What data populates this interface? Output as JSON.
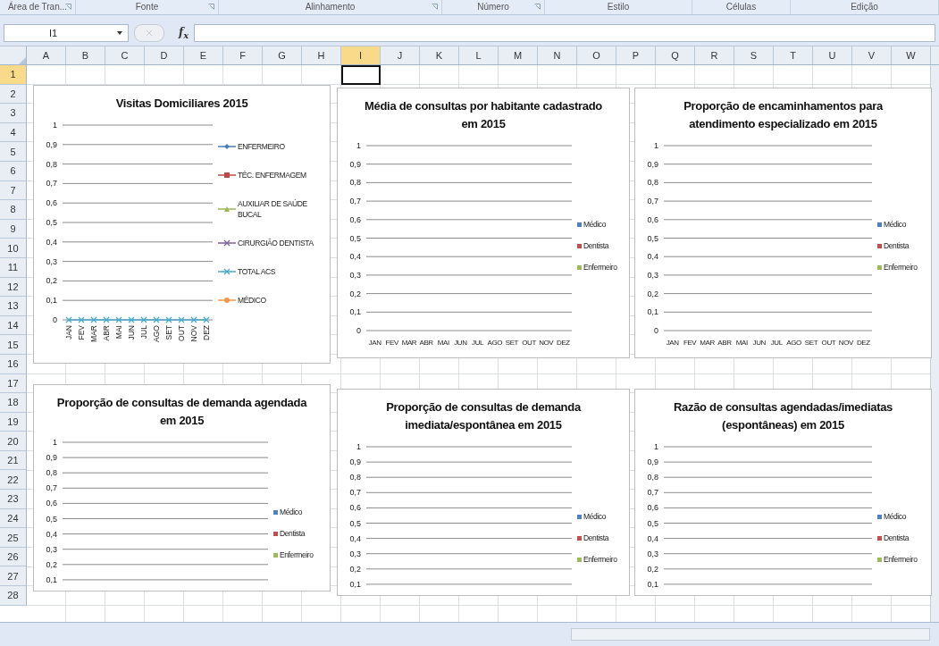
{
  "ribbon_groups": [
    {
      "label": "Área de Tran...",
      "has_launcher": true
    },
    {
      "label": "Fonte",
      "has_launcher": true
    },
    {
      "label": "Alinhamento",
      "has_launcher": true
    },
    {
      "label": "Número",
      "has_launcher": true
    },
    {
      "label": "Estilo",
      "has_launcher": false
    },
    {
      "label": "Células",
      "has_launcher": false
    },
    {
      "label": "Edição",
      "has_launcher": false
    }
  ],
  "formula_bar": {
    "name_box": "I1",
    "function_label": "f$_{x}$"
  },
  "columns": [
    {
      "label": "A",
      "selected": false
    },
    {
      "label": "B",
      "selected": false
    },
    {
      "label": "C",
      "selected": false
    },
    {
      "label": "D",
      "selected": false
    },
    {
      "label": "E",
      "selected": false
    },
    {
      "label": "F",
      "selected": false
    },
    {
      "label": "G",
      "selected": false
    },
    {
      "label": "H",
      "selected": false
    },
    {
      "label": "I",
      "selected": true
    },
    {
      "label": "J",
      "selected": false
    },
    {
      "label": "K",
      "selected": false
    },
    {
      "label": "L",
      "selected": false
    },
    {
      "label": "M",
      "selected": false
    },
    {
      "label": "N",
      "selected": false
    },
    {
      "label": "O",
      "selected": false
    },
    {
      "label": "P",
      "selected": false
    },
    {
      "label": "Q",
      "selected": false
    },
    {
      "label": "R",
      "selected": false
    },
    {
      "label": "S",
      "selected": false
    },
    {
      "label": "T",
      "selected": false
    },
    {
      "label": "U",
      "selected": false
    },
    {
      "label": "V",
      "selected": false
    },
    {
      "label": "W",
      "selected": false
    }
  ],
  "rows": [
    {
      "label": "1",
      "selected": true
    },
    {
      "label": "2",
      "selected": false
    },
    {
      "label": "3",
      "selected": false
    },
    {
      "label": "4",
      "selected": false
    },
    {
      "label": "5",
      "selected": false
    },
    {
      "label": "6",
      "selected": false
    },
    {
      "label": "7",
      "selected": false
    },
    {
      "label": "8",
      "selected": false
    },
    {
      "label": "9",
      "selected": false
    },
    {
      "label": "10",
      "selected": false
    },
    {
      "label": "11",
      "selected": false
    },
    {
      "label": "12",
      "selected": false
    },
    {
      "label": "13",
      "selected": false
    },
    {
      "label": "14",
      "selected": false
    },
    {
      "label": "15",
      "selected": false
    },
    {
      "label": "16",
      "selected": false
    },
    {
      "label": "17",
      "selected": false
    },
    {
      "label": "18",
      "selected": false
    },
    {
      "label": "19",
      "selected": false
    },
    {
      "label": "20",
      "selected": false
    },
    {
      "label": "21",
      "selected": false
    },
    {
      "label": "22",
      "selected": false
    },
    {
      "label": "23",
      "selected": false
    },
    {
      "label": "24",
      "selected": false
    },
    {
      "label": "25",
      "selected": false
    },
    {
      "label": "26",
      "selected": false
    },
    {
      "label": "27",
      "selected": false
    },
    {
      "label": "28",
      "selected": false
    }
  ],
  "charts": [
    {
      "chart_data": {
        "type": "line",
        "title": "Visitas Domiciliares 2015",
        "categories": [
          "JAN",
          "FEV",
          "MAR",
          "ABR",
          "MAI",
          "JUN",
          "JUL",
          "AGO",
          "SET",
          "OUT",
          "NOV",
          "DEZ"
        ],
        "ylim": [
          0,
          1
        ],
        "yticks": [
          {
            "value": 0,
            "label": "0"
          },
          {
            "value": 0.1,
            "label": "0,1"
          },
          {
            "value": 0.2,
            "label": "0,2"
          },
          {
            "value": 0.3,
            "label": "0,3"
          },
          {
            "value": 0.4,
            "label": "0,4"
          },
          {
            "value": 0.5,
            "label": "0,5"
          },
          {
            "value": 0.6,
            "label": "0,6"
          },
          {
            "value": 0.7,
            "label": "0,7"
          },
          {
            "value": 0.8,
            "label": "0,8"
          },
          {
            "value": 0.9,
            "label": "0,9"
          },
          {
            "value": 1,
            "label": "1"
          }
        ],
        "series": [
          {
            "name": "ENFERMEIRO",
            "color": "#4a7ebb",
            "marker": "diamond",
            "values": [
              null,
              null,
              null,
              null,
              null,
              null,
              null,
              null,
              null,
              null,
              null,
              null
            ]
          },
          {
            "name": "TÉC. ENFERMAGEM",
            "color": "#be4b48",
            "marker": "square",
            "values": [
              null,
              null,
              null,
              null,
              null,
              null,
              null,
              null,
              null,
              null,
              null,
              null
            ]
          },
          {
            "name": "AUXILIAR DE SAÚDE BUCAL",
            "color": "#98b954",
            "marker": "triangle",
            "values": [
              null,
              null,
              null,
              null,
              null,
              null,
              null,
              null,
              null,
              null,
              null,
              null
            ]
          },
          {
            "name": "CIRURGIÃO DENTISTA",
            "color": "#7d60a0",
            "marker": "cross",
            "values": [
              null,
              null,
              null,
              null,
              null,
              null,
              null,
              null,
              null,
              null,
              null,
              null
            ]
          },
          {
            "name": "TOTAL ACS",
            "color": "#46aac5",
            "marker": "cross",
            "values": [
              0,
              0,
              0,
              0,
              0,
              0,
              0,
              0,
              0,
              0,
              0,
              0
            ]
          },
          {
            "name": "MÉDICO",
            "color": "#f79646",
            "marker": "circle",
            "values": [
              null,
              null,
              null,
              null,
              null,
              null,
              null,
              null,
              null,
              null,
              null,
              null
            ]
          }
        ],
        "grid": true,
        "legend": "right"
      }
    },
    {
      "chart_data": {
        "type": "bar",
        "title": "Média de consultas por habitante cadastrado em 2015",
        "categories": [
          "JAN",
          "FEV",
          "MAR",
          "ABR",
          "MAI",
          "JUN",
          "JUL",
          "AGO",
          "SET",
          "OUT",
          "NOV",
          "DEZ"
        ],
        "ylim": [
          0,
          1
        ],
        "yticks": [
          {
            "value": 0,
            "label": "0"
          },
          {
            "value": 0.1,
            "label": "0,1"
          },
          {
            "value": 0.2,
            "label": "0,2"
          },
          {
            "value": 0.3,
            "label": "0,3"
          },
          {
            "value": 0.4,
            "label": "0,4"
          },
          {
            "value": 0.5,
            "label": "0,5"
          },
          {
            "value": 0.6,
            "label": "0,6"
          },
          {
            "value": 0.7,
            "label": "0,7"
          },
          {
            "value": 0.8,
            "label": "0,8"
          },
          {
            "value": 0.9,
            "label": "0,9"
          },
          {
            "value": 1,
            "label": "1"
          }
        ],
        "series": [
          {
            "name": "Médico",
            "color": "#4f81bd",
            "values": [
              0,
              0,
              0,
              0,
              0,
              0,
              0,
              0,
              0,
              0,
              0,
              0
            ]
          },
          {
            "name": "Dentista",
            "color": "#c0504d",
            "values": [
              0,
              0,
              0,
              0,
              0,
              0,
              0,
              0,
              0,
              0,
              0,
              0
            ]
          },
          {
            "name": "Enfermeiro",
            "color": "#9bbb59",
            "values": [
              0,
              0,
              0,
              0,
              0,
              0,
              0,
              0,
              0,
              0,
              0,
              0
            ]
          }
        ],
        "grid": true,
        "legend": "right"
      }
    },
    {
      "chart_data": {
        "type": "bar",
        "title": "Proporção de encaminhamentos para atendimento especializado em 2015",
        "categories": [
          "JAN",
          "FEV",
          "MAR",
          "ABR",
          "MAI",
          "JUN",
          "JUL",
          "AGO",
          "SET",
          "OUT",
          "NOV",
          "DEZ"
        ],
        "ylim": [
          0,
          1
        ],
        "yticks": [
          {
            "value": 0,
            "label": "0"
          },
          {
            "value": 0.1,
            "label": "0,1"
          },
          {
            "value": 0.2,
            "label": "0,2"
          },
          {
            "value": 0.3,
            "label": "0,3"
          },
          {
            "value": 0.4,
            "label": "0,4"
          },
          {
            "value": 0.5,
            "label": "0,5"
          },
          {
            "value": 0.6,
            "label": "0,6"
          },
          {
            "value": 0.7,
            "label": "0,7"
          },
          {
            "value": 0.8,
            "label": "0,8"
          },
          {
            "value": 0.9,
            "label": "0,9"
          },
          {
            "value": 1,
            "label": "1"
          }
        ],
        "series": [
          {
            "name": "Médico",
            "color": "#4f81bd",
            "values": [
              0,
              0,
              0,
              0,
              0,
              0,
              0,
              0,
              0,
              0,
              0,
              0
            ]
          },
          {
            "name": "Dentista",
            "color": "#c0504d",
            "values": [
              0,
              0,
              0,
              0,
              0,
              0,
              0,
              0,
              0,
              0,
              0,
              0
            ]
          },
          {
            "name": "Enfermeiro",
            "color": "#9bbb59",
            "values": [
              0,
              0,
              0,
              0,
              0,
              0,
              0,
              0,
              0,
              0,
              0,
              0
            ]
          }
        ],
        "grid": true,
        "legend": "right"
      }
    },
    {
      "chart_data": {
        "type": "bar",
        "title": "Proporção de consultas de demanda agendada em 2015",
        "ylim": [
          0,
          1
        ],
        "yticks": [
          {
            "value": 0.1,
            "label": "0,1"
          },
          {
            "value": 0.2,
            "label": "0,2"
          },
          {
            "value": 0.3,
            "label": "0,3"
          },
          {
            "value": 0.4,
            "label": "0,4"
          },
          {
            "value": 0.5,
            "label": "0,5"
          },
          {
            "value": 0.6,
            "label": "0,6"
          },
          {
            "value": 0.7,
            "label": "0,7"
          },
          {
            "value": 0.8,
            "label": "0,8"
          },
          {
            "value": 0.9,
            "label": "0,9"
          },
          {
            "value": 1,
            "label": "1"
          }
        ],
        "series": [
          {
            "name": "Médico",
            "color": "#4f81bd"
          },
          {
            "name": "Dentista",
            "color": "#c0504d"
          },
          {
            "name": "Enfermeiro",
            "color": "#9bbb59"
          }
        ],
        "grid": true,
        "legend": "right"
      }
    },
    {
      "chart_data": {
        "type": "bar",
        "title": "Proporção de consultas de demanda imediata/espontânea em 2015",
        "ylim": [
          0,
          1
        ],
        "yticks": [
          {
            "value": 0.1,
            "label": "0,1"
          },
          {
            "value": 0.2,
            "label": "0,2"
          },
          {
            "value": 0.3,
            "label": "0,3"
          },
          {
            "value": 0.4,
            "label": "0,4"
          },
          {
            "value": 0.5,
            "label": "0,5"
          },
          {
            "value": 0.6,
            "label": "0,6"
          },
          {
            "value": 0.7,
            "label": "0,7"
          },
          {
            "value": 0.8,
            "label": "0,8"
          },
          {
            "value": 0.9,
            "label": "0,9"
          },
          {
            "value": 1,
            "label": "1"
          }
        ],
        "series": [
          {
            "name": "Médico",
            "color": "#4f81bd"
          },
          {
            "name": "Dentista",
            "color": "#c0504d"
          },
          {
            "name": "Enfermeiro",
            "color": "#9bbb59"
          }
        ],
        "grid": true,
        "legend": "right"
      }
    },
    {
      "chart_data": {
        "type": "bar",
        "title": "Razão de consultas agendadas/imediatas (espontâneas) em 2015",
        "ylim": [
          0,
          1
        ],
        "yticks": [
          {
            "value": 0.1,
            "label": "0,1"
          },
          {
            "value": 0.2,
            "label": "0,2"
          },
          {
            "value": 0.3,
            "label": "0,3"
          },
          {
            "value": 0.4,
            "label": "0,4"
          },
          {
            "value": 0.5,
            "label": "0,5"
          },
          {
            "value": 0.6,
            "label": "0,6"
          },
          {
            "value": 0.7,
            "label": "0,7"
          },
          {
            "value": 0.8,
            "label": "0,8"
          },
          {
            "value": 0.9,
            "label": "0,9"
          },
          {
            "value": 1,
            "label": "1"
          }
        ],
        "series": [
          {
            "name": "Médico",
            "color": "#4f81bd"
          },
          {
            "name": "Dentista",
            "color": "#c0504d"
          },
          {
            "name": "Enfermeiro",
            "color": "#9bbb59"
          }
        ],
        "grid": true,
        "legend": "right"
      }
    }
  ]
}
